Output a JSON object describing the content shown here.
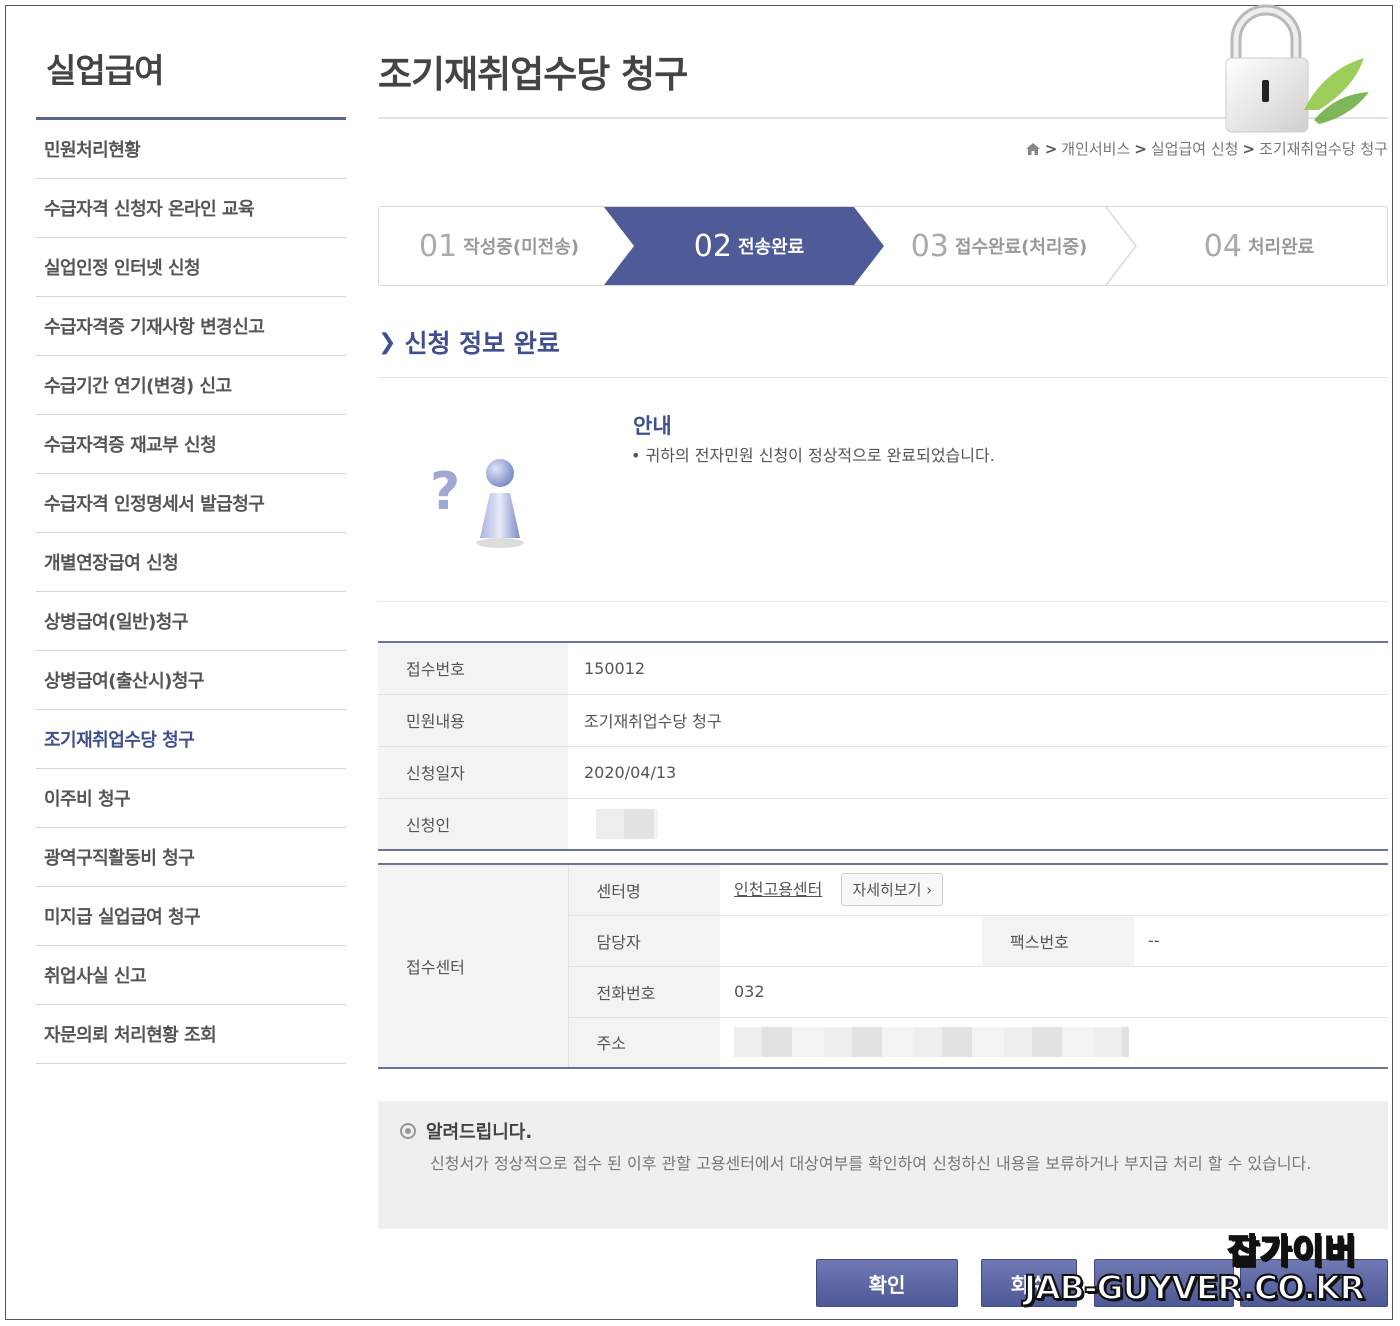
{
  "sidebar": {
    "title": "실업급여",
    "items": [
      {
        "label": "민원처리현황"
      },
      {
        "label": "수급자격 신청자 온라인 교육"
      },
      {
        "label": "실업인정 인터넷 신청"
      },
      {
        "label": "수급자격증 기재사항 변경신고"
      },
      {
        "label": "수급기간 연기(변경) 신고"
      },
      {
        "label": "수급자격증 재교부 신청"
      },
      {
        "label": "수급자격 인정명세서 발급청구"
      },
      {
        "label": "개별연장급여 신청"
      },
      {
        "label": "상병급여(일반)청구"
      },
      {
        "label": "상병급여(출산시)청구"
      },
      {
        "label": "조기재취업수당 청구"
      },
      {
        "label": "이주비 청구"
      },
      {
        "label": "광역구직활동비 청구"
      },
      {
        "label": "미지급 실업급여 청구"
      },
      {
        "label": "취업사실 신고"
      },
      {
        "label": "자문의뢰 처리현황 조회"
      }
    ],
    "active_index": 10,
    "accent_color": "#3f4f8f"
  },
  "header": {
    "title": "조기재취업수당 청구",
    "breadcrumb": [
      "개인서비스",
      "실업급여 신청",
      "조기재취업수당 청구"
    ],
    "lock_icon": "padlock-icon",
    "home_icon": "home-icon"
  },
  "steps": [
    {
      "num": "01",
      "label": "작성중(미전송)"
    },
    {
      "num": "02",
      "label": "전송완료"
    },
    {
      "num": "03",
      "label": "접수완료(처리중)"
    },
    {
      "num": "04",
      "label": "처리완료"
    }
  ],
  "current_step": 1,
  "section": {
    "title": "신청 정보 완료"
  },
  "info": {
    "title": "안내",
    "text": "• 귀하의 전자민원 신청이 정상적으로 완료되었습니다."
  },
  "details": [
    {
      "label": "접수번호",
      "value": "150012"
    },
    {
      "label": "민원내용",
      "value": "조기재취업수당 청구"
    },
    {
      "label": "신청일자",
      "value": "2020/04/13"
    },
    {
      "label": "신청인",
      "value": ""
    }
  ],
  "center": {
    "label": "접수센터",
    "name_label": "센터명",
    "name_value": "인천고용센터",
    "detail_button": "자세히보기 ›",
    "manager_label": "담당자",
    "manager_value": "",
    "fax_label": "팩스번호",
    "fax_value": "--",
    "phone_label": "전화번호",
    "phone_value": "032",
    "address_label": "주소",
    "address_value": ""
  },
  "notice": {
    "title": "알려드립니다.",
    "text": "신청서가 정상적으로 접수 된 이후 관할 고용센터에서 대상여부를 확인하여 신청하신 내용을 보류하거나 부지급 처리 할 수 있습니다."
  },
  "buttons": {
    "confirm": "확인",
    "withdraw": "회수"
  },
  "watermark": {
    "line1": "잡가이버",
    "line2": "JAB-GUYVER.CO.KR"
  }
}
